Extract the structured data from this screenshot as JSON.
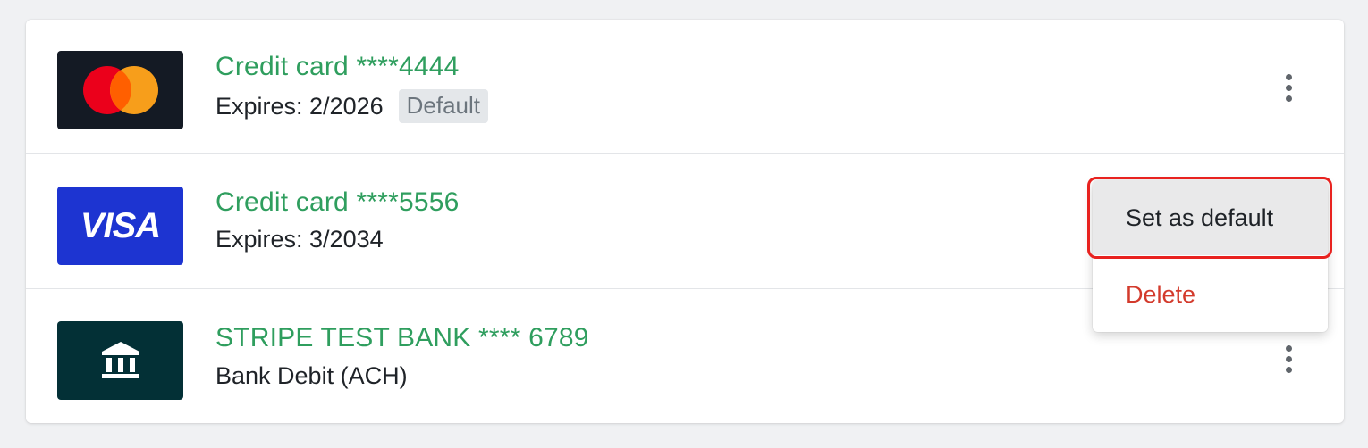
{
  "payment_methods": [
    {
      "brand_icon": "mastercard-icon",
      "title": "Credit card ****4444",
      "subtitle": "Expires: 2/2026",
      "badge": "Default"
    },
    {
      "brand_icon": "visa-icon",
      "brand_text": "VISA",
      "title": "Credit card ****5556",
      "subtitle": "Expires: 3/2034"
    },
    {
      "brand_icon": "bank-icon",
      "title": "STRIPE TEST BANK **** 6789",
      "subtitle": "Bank Debit (ACH)"
    }
  ],
  "context_menu": {
    "set_default_label": "Set as default",
    "delete_label": "Delete"
  },
  "colors": {
    "title_green": "#2f9e5e",
    "delete_red": "#d33a2c",
    "highlight_red": "#e8221f",
    "mastercard_bg": "#141a24",
    "visa_bg": "#1d34d1",
    "bank_bg": "#033036"
  }
}
